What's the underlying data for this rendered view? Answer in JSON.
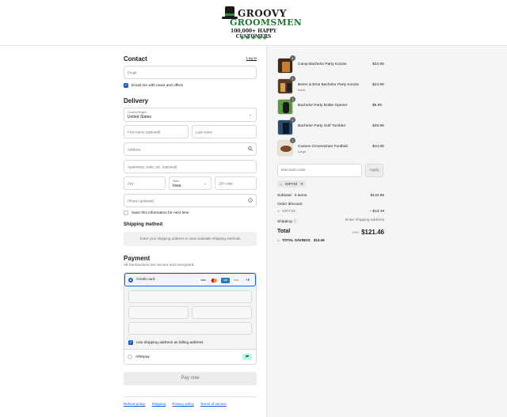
{
  "header": {
    "brand_line1": "GROOVY",
    "brand_line2": "GROOMSMEN",
    "tagline": "100,000+ HAPPY CUSTOMERS",
    "stars": "★★★★★"
  },
  "contact": {
    "title": "Contact",
    "login_link": "Log in",
    "email_placeholder": "Email",
    "email_news_label": "Email me with news and offers",
    "email_news_checked": true
  },
  "delivery": {
    "title": "Delivery",
    "country_label": "Country/Region",
    "country_value": "United States",
    "first_name_placeholder": "First name (optional)",
    "last_name_placeholder": "Last name",
    "address_placeholder": "Address",
    "apartment_placeholder": "Apartment, suite, etc. (optional)",
    "city_placeholder": "City",
    "state_label": "State",
    "state_value": "Iowa",
    "zip_placeholder": "ZIP code",
    "phone_placeholder": "Phone (optional)",
    "save_info_label": "Save this information for next time",
    "save_info_checked": false
  },
  "shipping_method": {
    "title": "Shipping method",
    "notice": "Enter your shipping address to view available shipping methods"
  },
  "payment": {
    "title": "Payment",
    "subtitle": "All transactions are secure and encrypted.",
    "credit_card_label": "Credit card",
    "card_brands": [
      "VISA",
      "MC",
      "AMEX",
      "DISC"
    ],
    "more_cards": "+5",
    "billing_same_label": "Use shipping address as billing address",
    "billing_same_checked": true,
    "afterpay_label": "Afterpay",
    "pay_button": "Pay now"
  },
  "footer_links": [
    "Refund policy",
    "Shipping",
    "Privacy policy",
    "Terms of service"
  ],
  "order": {
    "items": [
      {
        "qty": "1",
        "name": "Camp Bachelor Party Koozie",
        "variant": "",
        "price": "$24.99"
      },
      {
        "qty": "1",
        "name": "Beers & Bros Bachelor Party Koozie",
        "variant": "black",
        "price": "$24.99"
      },
      {
        "qty": "1",
        "name": "Bachelor Party Bottle Opener",
        "variant": "",
        "price": "$9.99"
      },
      {
        "qty": "1",
        "name": "Bachelor Party Golf Tumbler",
        "variant": "",
        "price": "$29.99"
      },
      {
        "qty": "1",
        "name": "Custom Groomsman Football",
        "variant": "Large",
        "price": "$44.99"
      }
    ],
    "discount_placeholder": "Discount code",
    "apply_label": "Apply",
    "applied_code": "GIFT10",
    "subtotal_label": "Subtotal · 5 items",
    "subtotal_value": "$134.95",
    "order_discount_label": "Order discount",
    "discount_code": "GIFT10",
    "discount_value": "– $13.49",
    "shipping_label": "Shipping",
    "shipping_value": "Enter shipping address",
    "total_label": "Total",
    "currency": "USD",
    "total_value": "$121.46",
    "savings_label": "TOTAL SAVINGS",
    "savings_value": "$13.49"
  },
  "colors": {
    "accent": "#1a5fd1",
    "brand_green": "#1e7a34",
    "summary_bg": "#f5f5f5"
  }
}
